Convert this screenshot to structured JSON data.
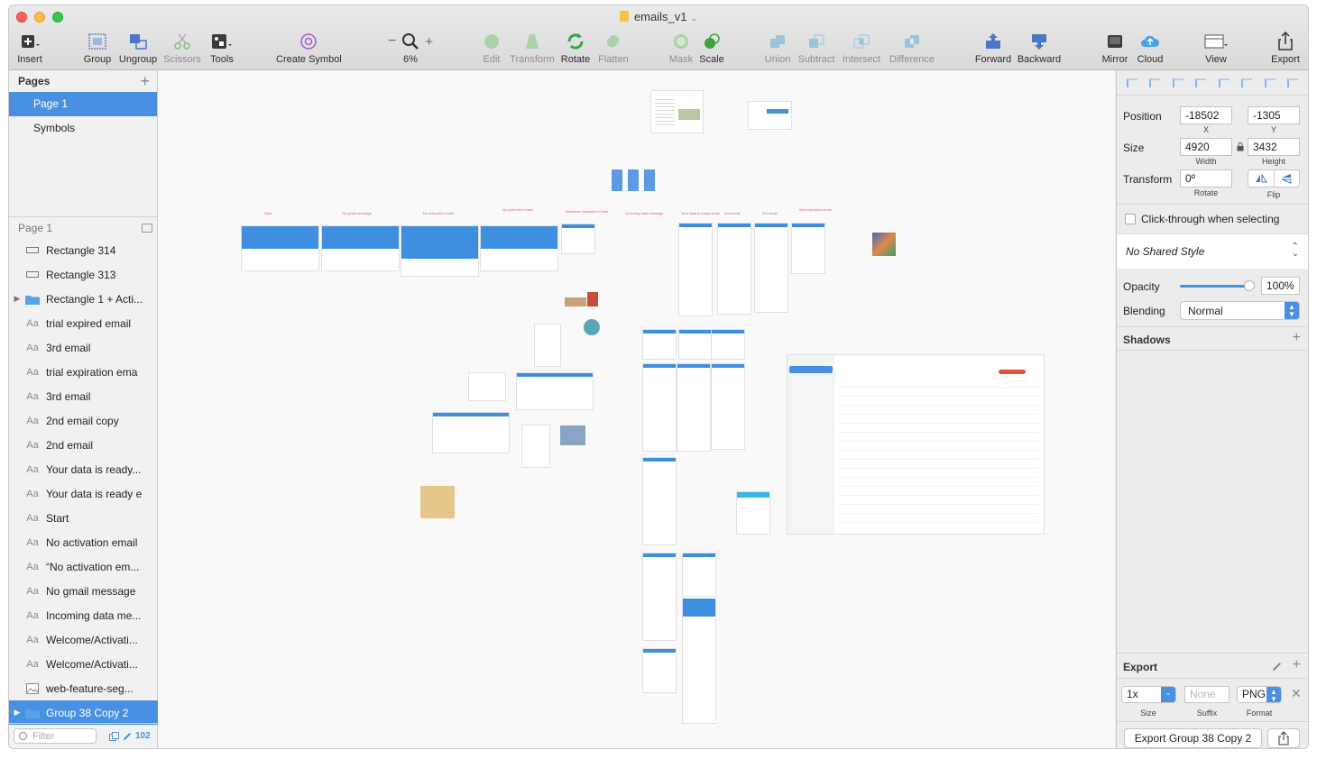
{
  "window": {
    "title": "emails_v1"
  },
  "toolbar": {
    "insert": "Insert",
    "group": "Group",
    "ungroup": "Ungroup",
    "scissors": "Scissors",
    "tools": "Tools",
    "create_symbol": "Create Symbol",
    "zoom": "6%",
    "edit": "Edit",
    "transform": "Transform",
    "rotate": "Rotate",
    "flatten": "Flatten",
    "mask": "Mask",
    "scale": "Scale",
    "union": "Union",
    "subtract": "Subtract",
    "intersect": "Intersect",
    "difference": "Difference",
    "forward": "Forward",
    "backward": "Backward",
    "mirror": "Mirror",
    "cloud": "Cloud",
    "view": "View",
    "export": "Export"
  },
  "pages": {
    "title": "Pages",
    "items": [
      "Page 1",
      "Symbols"
    ],
    "selected": "Page 1"
  },
  "layers": {
    "header": "Page 1",
    "items": [
      {
        "label": "Rectangle 314",
        "icon": "rectangle-icon"
      },
      {
        "label": "Rectangle 313",
        "icon": "rectangle-icon"
      },
      {
        "label": "Rectangle 1 + Acti...",
        "icon": "folder-icon"
      },
      {
        "label": "trial expired email",
        "icon": "text-icon"
      },
      {
        "label": "3rd email",
        "icon": "text-icon"
      },
      {
        "label": "trial expiration ema",
        "icon": "text-icon"
      },
      {
        "label": "3rd email",
        "icon": "text-icon"
      },
      {
        "label": "2nd email copy",
        "icon": "text-icon"
      },
      {
        "label": "2nd email",
        "icon": "text-icon"
      },
      {
        "label": "Your data is ready...",
        "icon": "text-icon"
      },
      {
        "label": "Your data is ready e",
        "icon": "text-icon"
      },
      {
        "label": "Start",
        "icon": "text-icon"
      },
      {
        "label": "No activation email",
        "icon": "text-icon"
      },
      {
        "label": "“No activation em...",
        "icon": "text-icon"
      },
      {
        "label": "No gmail message",
        "icon": "text-icon"
      },
      {
        "label": "Incoming data me...",
        "icon": "text-icon"
      },
      {
        "label": "Welcome/Activati...",
        "icon": "text-icon"
      },
      {
        "label": "Welcome/Activati...",
        "icon": "text-icon"
      },
      {
        "label": "web-feature-seg...",
        "icon": "image-icon"
      },
      {
        "label": "Group 38 Copy 2",
        "icon": "folder-icon"
      }
    ],
    "filter_placeholder": "Filter",
    "count": "102"
  },
  "inspector": {
    "position_label": "Position",
    "x": "-18502",
    "y": "-1305",
    "x_label": "X",
    "y_label": "Y",
    "size_label": "Size",
    "width": "4920",
    "height": "3432",
    "width_label": "Width",
    "height_label": "Height",
    "transform_label": "Transform",
    "rotate": "0º",
    "rotate_label": "Rotate",
    "flip_label": "Flip",
    "click_through": "Click-through when selecting",
    "shared_style": "No Shared Style",
    "opacity_label": "Opacity",
    "opacity": "100%",
    "blending_label": "Blending",
    "blending": "Normal",
    "shadows": "Shadows",
    "export_title": "Export",
    "export_size": "1x",
    "suffix_placeholder": "None",
    "format": "PNG",
    "size_sub": "Size",
    "suffix_sub": "Suffix",
    "format_sub": "Format",
    "export_button": "Export Group 38 Copy 2"
  },
  "colors": {
    "accent": "#4a90e2",
    "selection": "#4a90e2",
    "annotation": "#e55a8a"
  }
}
